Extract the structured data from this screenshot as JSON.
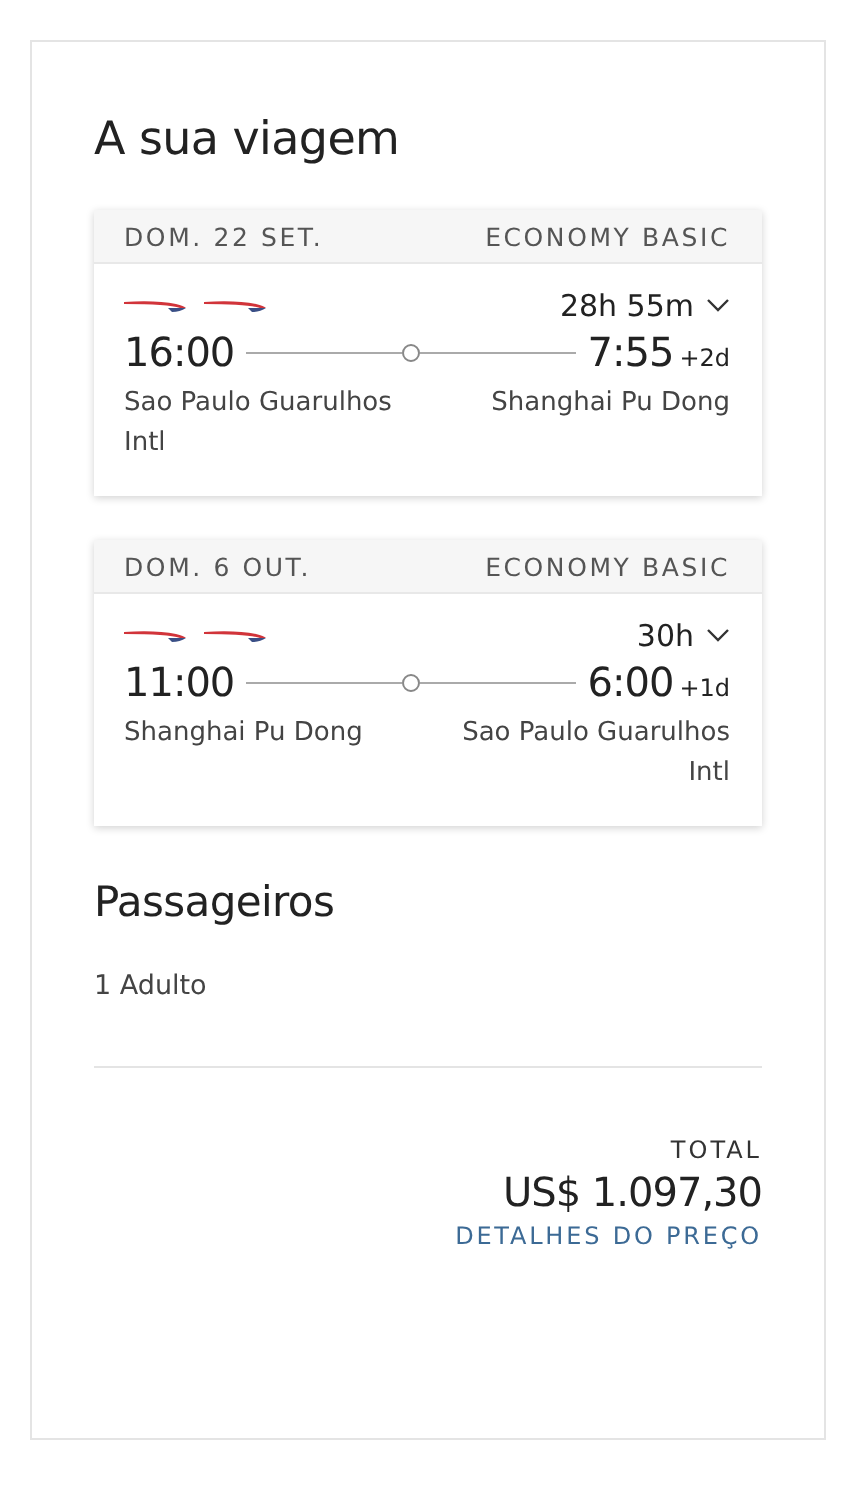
{
  "title": "A sua viagem",
  "flights": [
    {
      "date": "DOM. 22 SET.",
      "cabin": "ECONOMY BASIC",
      "duration": "28h 55m",
      "depart_time": "16:00",
      "arrive_time": "7:55",
      "day_offset": "+2d",
      "origin": "Sao Paulo Guarulhos Intl",
      "destination": "Shanghai Pu Dong",
      "expanded": false
    },
    {
      "date": "DOM. 6 OUT.",
      "cabin": "ECONOMY BASIC",
      "duration": "30h",
      "depart_time": "11:00",
      "arrive_time": "6:00",
      "day_offset": "+1d",
      "origin": "Shanghai Pu Dong",
      "destination": "Sao Paulo Guarulhos Intl",
      "expanded": false
    }
  ],
  "passengers": {
    "heading": "Passageiros",
    "summary": "1 Adulto"
  },
  "total": {
    "label": "TOTAL",
    "amount": "US$ 1.097,30",
    "details_link": "DETALHES DO PREÇO"
  }
}
